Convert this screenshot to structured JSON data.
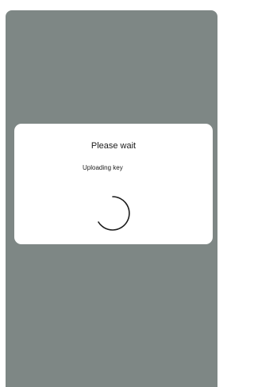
{
  "dialog": {
    "title": "Please wait",
    "message": "Uploading key",
    "spinner_icon": "progress-spinner-icon"
  },
  "colors": {
    "backdrop": "#7e8785",
    "dialog_background": "#ffffff",
    "text": "#1b1b1b"
  }
}
